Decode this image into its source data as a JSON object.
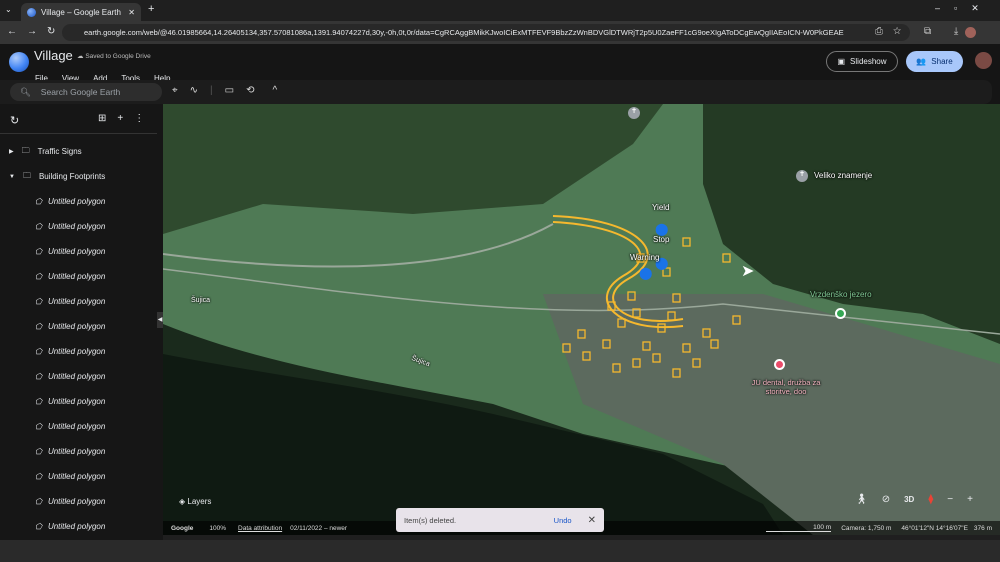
{
  "browser": {
    "tab_title": "Village – Google Earth",
    "url": "earth.google.com/web/@46.01985664,14.26405134,357.57081086a,1391.94074227d,30y,-0h,0t,0r/data=CgRCAggBMikKJwoICiExMTFEVF9BbzZzWnBDVGlDTWRjT2p5U0ZaeFF1cG9oeXIgAToDCgEwQgIIAEoICN-W0PkGEAE"
  },
  "app": {
    "project_title": "Village",
    "save_status": "Saved to Google Drive",
    "menu": [
      "File",
      "View",
      "Add",
      "Tools",
      "Help"
    ],
    "slideshow_label": "Slideshow",
    "share_label": "Share",
    "search_placeholder": "Search Google Earth"
  },
  "sidebar": {
    "folders": [
      {
        "label": "Traffic Signs",
        "expanded": false
      },
      {
        "label": "Building Footprints",
        "expanded": true
      }
    ],
    "items": [
      "Untitled polygon",
      "Untitled polygon",
      "Untitled polygon",
      "Untitled polygon",
      "Untitled polygon",
      "Untitled polygon",
      "Untitled polygon",
      "Untitled polygon",
      "Untitled polygon",
      "Untitled polygon",
      "Untitled polygon",
      "Untitled polygon",
      "Untitled polygon",
      "Untitled polygon"
    ]
  },
  "map": {
    "labels": {
      "veliko": "Veliko znamenje",
      "yield": "Yield",
      "stop": "Stop",
      "warning": "Warning",
      "vrzdensko": "Vrzdenško jezero",
      "dental": "JU dental, družba za storitve, doo",
      "sujica1": "Šujica",
      "sujica2": "Šujica"
    },
    "layers_label": "Layers",
    "mode_3d": "3D"
  },
  "status": {
    "brand": "Google",
    "zoom": "100%",
    "attribution": "Data attribution",
    "imagery_date": "02/11/2022 – newer",
    "scale": "100 m",
    "camera": "Camera: 1,750 m",
    "coords": "46°01'12\"N 14°16'07\"E",
    "elevation": "376 m"
  },
  "toast": {
    "message": "Item(s) deleted.",
    "undo": "Undo"
  },
  "colors": {
    "accent": "#a8c7fa",
    "polygon": "#f5b82e",
    "pin": "#1a73e8"
  }
}
